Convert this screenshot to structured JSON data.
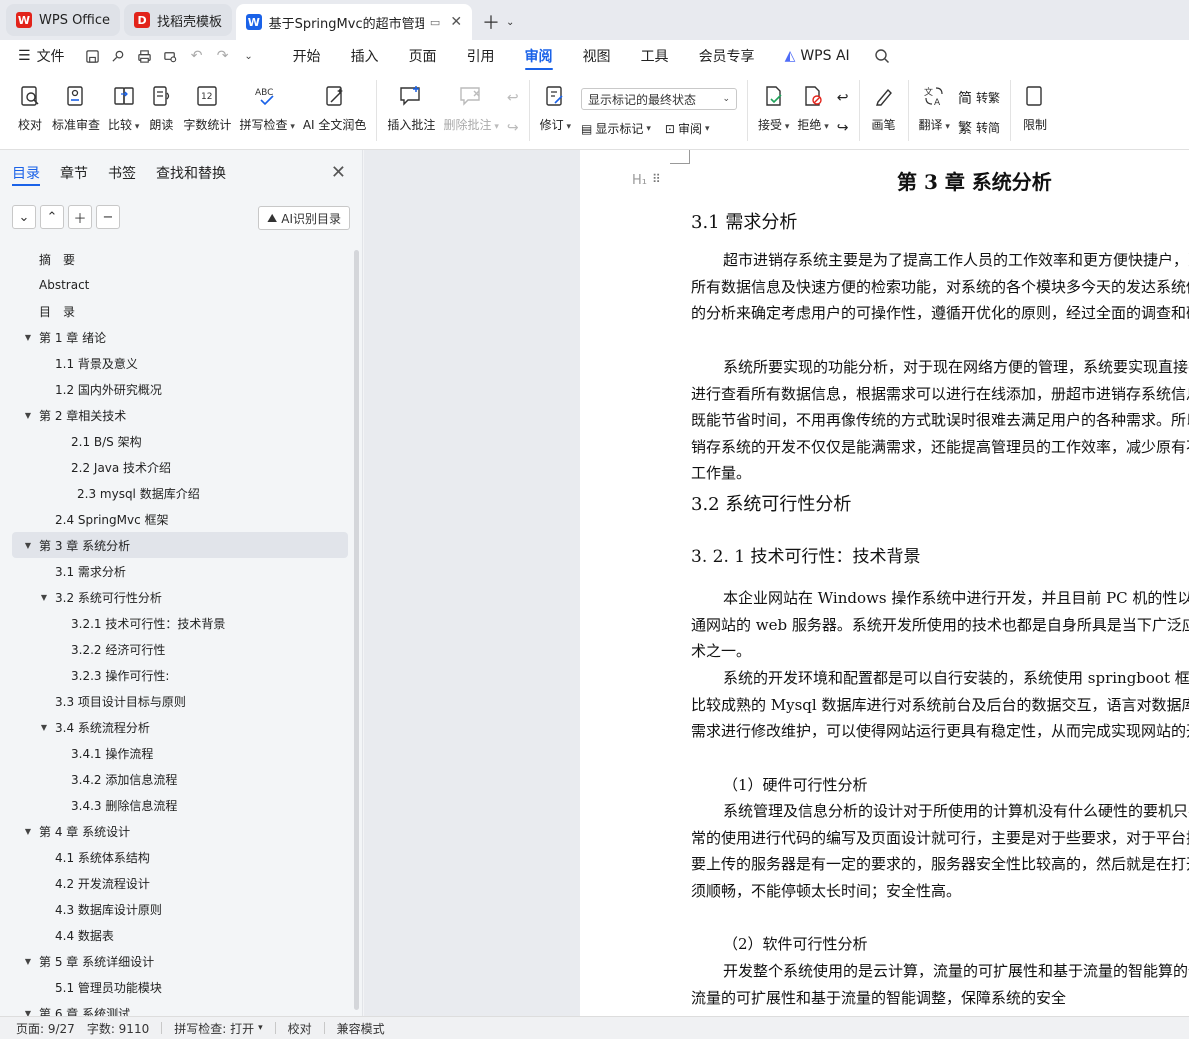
{
  "tabs": [
    {
      "label": "WPS Office"
    },
    {
      "label": "找稻壳模板"
    },
    {
      "label": "基于SpringMvc的超市管理系"
    }
  ],
  "menu": {
    "file": "文件",
    "items": [
      "开始",
      "插入",
      "页面",
      "引用",
      "审阅",
      "视图",
      "工具",
      "会员专享"
    ],
    "active": "审阅",
    "wpsai": "WPS AI"
  },
  "ribbon": {
    "proofread": "校对",
    "standard_review": "标准审查",
    "compare": "比较",
    "read_aloud": "朗读",
    "word_count": "字数统计",
    "spell_check": "拼写检查",
    "ai_polish": "AI 全文润色",
    "insert_comment": "插入批注",
    "delete_comment": "删除批注",
    "track": "修订",
    "markup_select": "显示标记的最终状态",
    "show_markup": "显示标记",
    "review": "审阅",
    "accept": "接受",
    "reject": "拒绝",
    "pen": "画笔",
    "translate": "翻译",
    "to_simplified": "简",
    "to_simplified_label": "转繁",
    "to_traditional": "繁",
    "to_traditional_label": "转简",
    "restrict": "限制"
  },
  "nav": {
    "tabs": [
      "目录",
      "章节",
      "书签",
      "查找和替换"
    ],
    "ai_button": "AI识别目录"
  },
  "toc": [
    {
      "label": "摘　要",
      "level": 0
    },
    {
      "label": "Abstract",
      "level": 0
    },
    {
      "label": "目　录",
      "level": 0
    },
    {
      "label": "第 1 章  绪论",
      "level": 0,
      "arrow": true
    },
    {
      "label": "1.1 背景及意义",
      "level": 1
    },
    {
      "label": "1.2  国内外研究概况",
      "level": 1
    },
    {
      "label": "第 2 章相关技术",
      "level": 0,
      "arrow": true
    },
    {
      "label": "2.1   B/S 架构",
      "level": 2
    },
    {
      "label": "2.2   Java 技术介绍",
      "level": 2
    },
    {
      "label": "2.3 mysql 数据库介绍",
      "level": 3
    },
    {
      "label": "2.4 SpringMvc 框架",
      "level": 1
    },
    {
      "label": "第 3 章  系统分析",
      "level": 0,
      "arrow": true,
      "selected": true
    },
    {
      "label": "3.1  需求分析",
      "level": 1
    },
    {
      "label": "3.2  系统可行性分析",
      "level": 1,
      "arrow": true
    },
    {
      "label": "3.2.1 技术可行性：技术背景",
      "level": 2
    },
    {
      "label": "3.2.2 经济可行性",
      "level": 2
    },
    {
      "label": "3.2.3 操作可行性:",
      "level": 2
    },
    {
      "label": "3.3  项目设计目标与原则",
      "level": 1
    },
    {
      "label": "3.4 系统流程分析",
      "level": 1,
      "arrow": true
    },
    {
      "label": "3.4.1 操作流程",
      "level": 2
    },
    {
      "label": "3.4.2 添加信息流程",
      "level": 2
    },
    {
      "label": "3.4.3 删除信息流程",
      "level": 2
    },
    {
      "label": "第 4 章  系统设计",
      "level": 0,
      "arrow": true
    },
    {
      "label": "4.1  系统体系结构",
      "level": 1
    },
    {
      "label": "4.2 开发流程设计",
      "level": 1
    },
    {
      "label": "4.3  数据库设计原则",
      "level": 1
    },
    {
      "label": "4.4  数据表",
      "level": 1
    },
    {
      "label": "第 5 章  系统详细设计",
      "level": 0,
      "arrow": true
    },
    {
      "label": "5.1 管理员功能模块",
      "level": 1
    },
    {
      "label": "第 6 章  系统测试",
      "level": 0,
      "arrow": true
    }
  ],
  "doc": {
    "chapter_title": "第 3 章  系统分析",
    "h_3_1": "3.1  需求分析",
    "p1": "超市进销存系统主要是为了提高工作人员的工作效率和更方便快捷户，更好存储所有数据信息及快速方便的检索功能，对系统的各个模块多今天的发达系统做出合理的分析来确定考虑用户的可操作性，遵循开优化的原则，经过全面的调查和研究。",
    "p2": "系统所要实现的功能分析，对于现在网络方便的管理，系统要实现直接在平台上进行查看所有数据信息，根据需求可以进行在线添加，册超市进销存系统信息，这样既能节省时间，不用再像传统的方式耽误时很难去满足用户的各种需求。所以超市进销存系统的开发不仅仅是能满需求，还能提高管理员的工作效率，减少原有不必要的工作量。",
    "h_3_2": "3.2  系统可行性分析",
    "h_3_2_1": "3. 2. 1 技术可行性：技术背景",
    "p3": "本企业网站在 Windows 操作系统中进行开发，并且目前 PC 机的性以胜任普通网站的 web 服务器。系统开发所使用的技术也都是自身所具是当下广泛应用的技术之一。",
    "p4": "系统的开发环境和配置都是可以自行安装的，系统使用 springboot 框具，使用比较成熟的 Mysql 数据库进行对系统前台及后台的数据交互，语言对数据库，结合需求进行修改维护，可以使得网站运行更具有稳定性，从而完成实现网站的开发。",
    "sub1": "（1）硬件可行性分析",
    "p5": "系统管理及信息分析的设计对于所使用的计算机没有什么硬性的要机只要可以正常的使用进行代码的编写及页面设计就可行，主要是对于些要求，对于平台搭建完成要上传的服务器是有一定的要求的，服务器安全性比较高的，然后就是在打开网站必须顺畅，不能停顿太长时间；安全性高。",
    "sub2": "（2）软件可行性分析",
    "p6": "开发整个系统使用的是云计算，流量的可扩展性和基于流量的智能算的优点就是流量的可扩展性和基于流量的智能调整，保障系统的安全"
  },
  "status": {
    "page": "页面: 9/27",
    "words": "字数: 9110",
    "spell": "拼写检查: 打开",
    "proof": "校对",
    "compat": "兼容模式"
  },
  "colors": {
    "accent": "#1a62e8",
    "wps_red": "#e2231a"
  }
}
